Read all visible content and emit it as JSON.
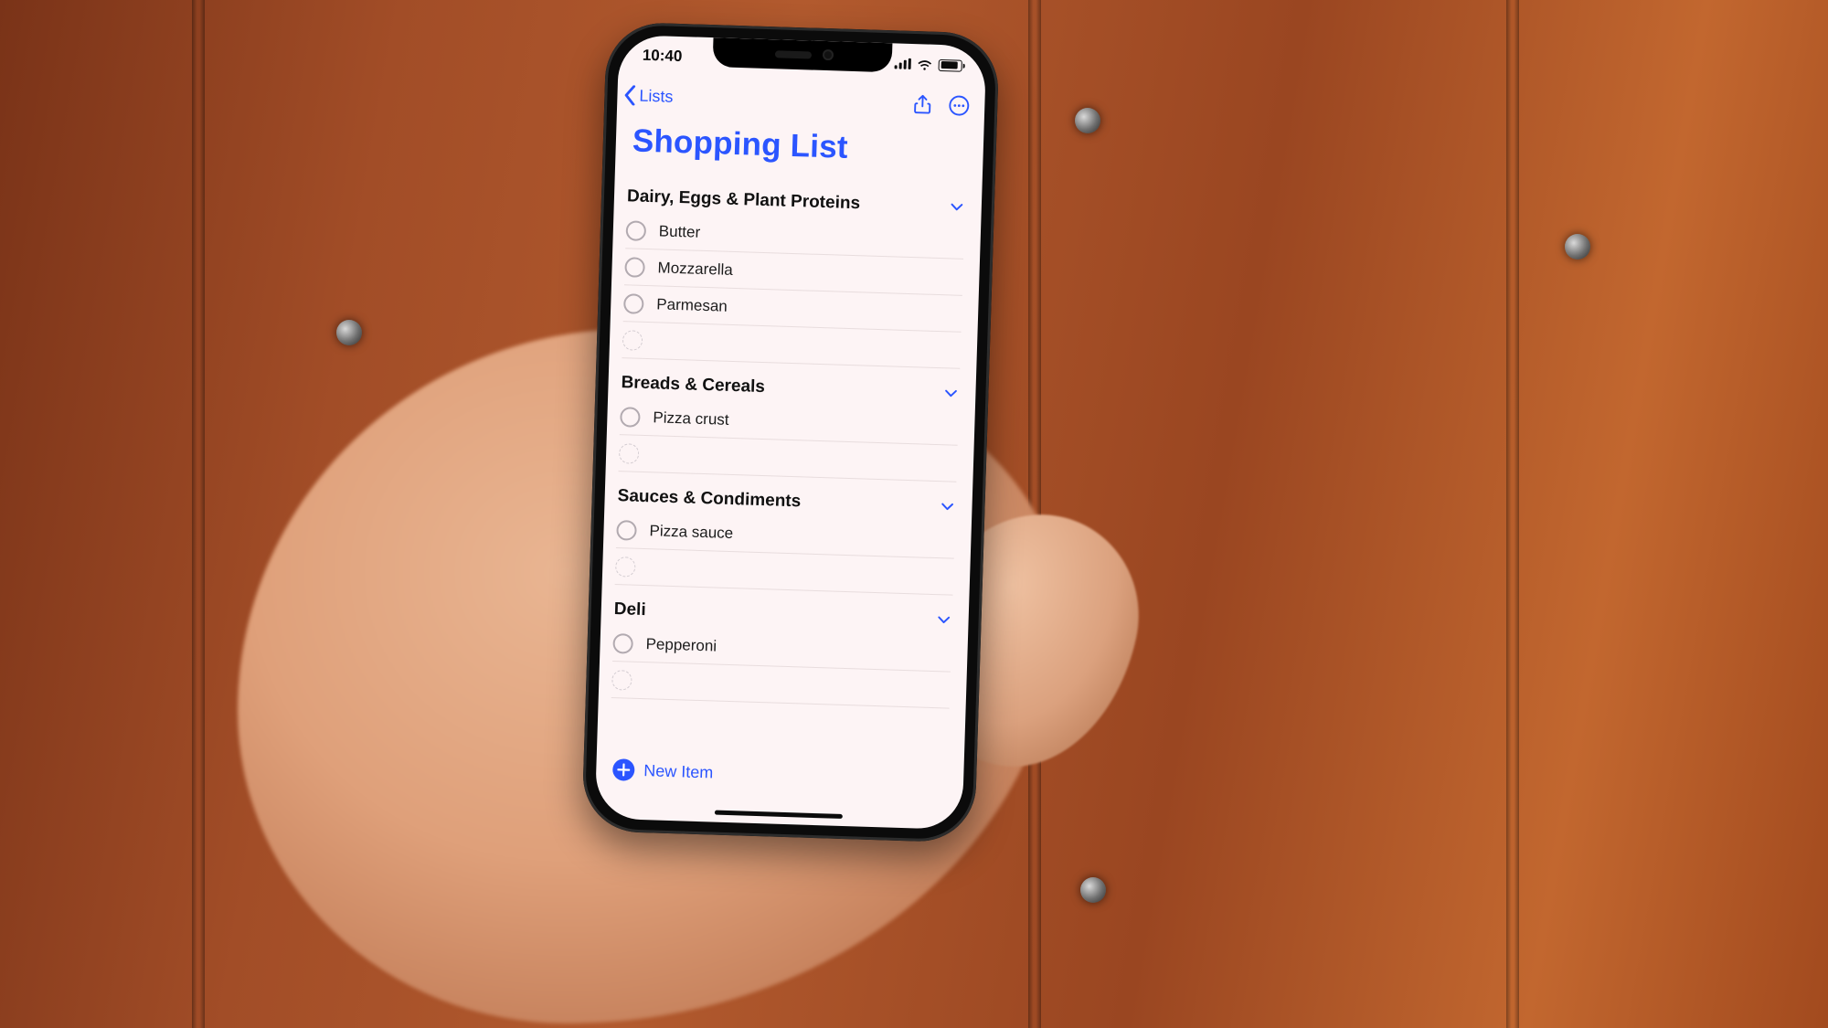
{
  "statusbar": {
    "time": "10:40"
  },
  "nav": {
    "back_label": "Lists",
    "share_icon": "share-icon",
    "more_icon": "ellipsis-circle-icon"
  },
  "title": "Shopping List",
  "new_item_label": "New Item",
  "sections": [
    {
      "title": "Dairy, Eggs & Plant Proteins",
      "items": [
        "Butter",
        "Mozzarella",
        "Parmesan"
      ]
    },
    {
      "title": "Breads & Cereals",
      "items": [
        "Pizza crust"
      ]
    },
    {
      "title": "Sauces & Condiments",
      "items": [
        "Pizza sauce"
      ]
    },
    {
      "title": "Deli",
      "items": [
        "Pepperoni"
      ]
    }
  ],
  "colors": {
    "accent": "#2b55ff"
  }
}
